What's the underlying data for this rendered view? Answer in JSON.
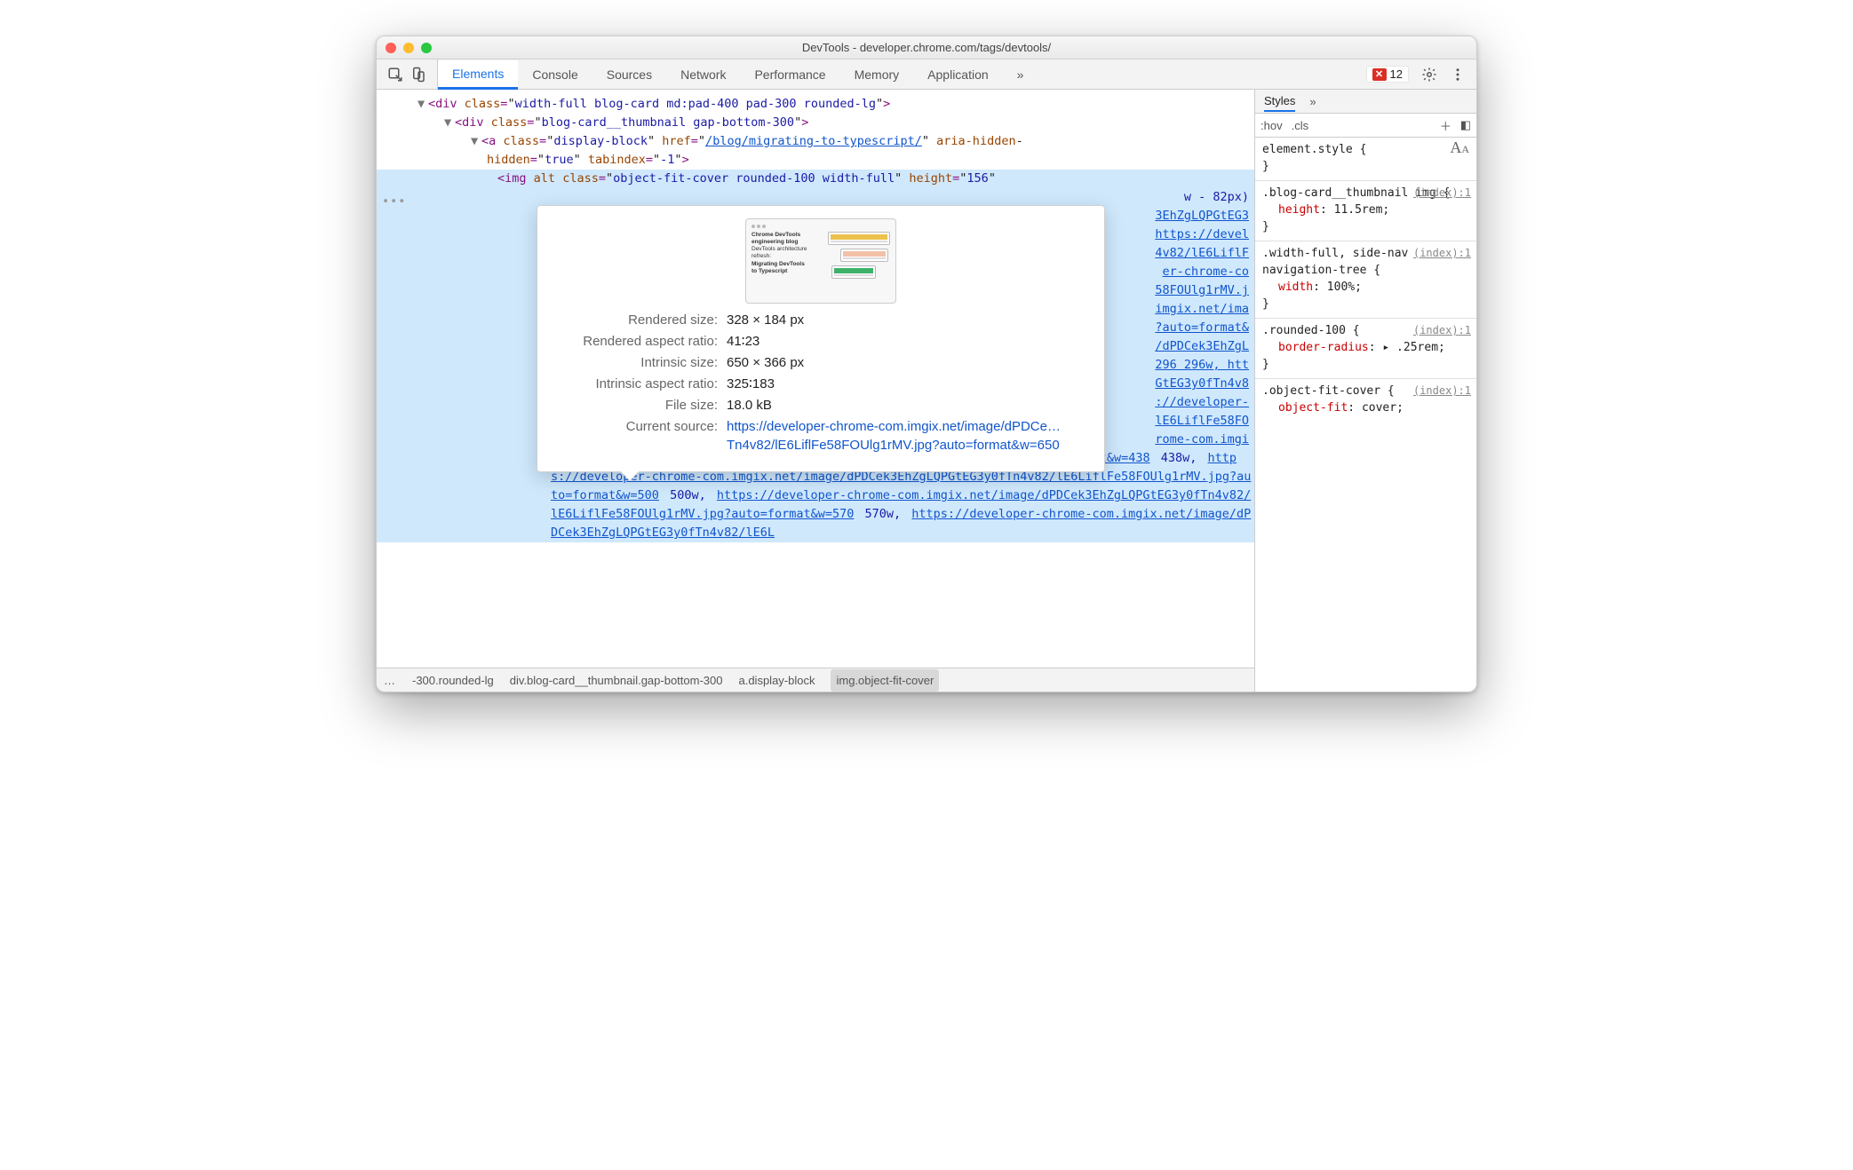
{
  "window": {
    "title": "DevTools - developer.chrome.com/tags/devtools/"
  },
  "toolbar": {
    "tabs": [
      "Elements",
      "Console",
      "Sources",
      "Network",
      "Performance",
      "Memory",
      "Application"
    ],
    "active": 0,
    "errors": "12"
  },
  "dom": {
    "line1_class": "width-full blog-card md:pad-400 pad-300 rounded-lg",
    "line2_class": "blog-card__thumbnail gap-bottom-300",
    "a_class": "display-block",
    "a_href": "/blog/migrating-to-typescript/",
    "a_aria_attr": "aria-hidden",
    "a_aria_val": "true",
    "a_tabindex_attr": "tabindex",
    "a_tabindex_val": "-1",
    "img_class": "object-fit-cover rounded-100 width-full",
    "img_height": "156",
    "vw_frag": "w - 82px)",
    "srcset_frags": [
      "3EhZgLQPGtEG3",
      "https://devel",
      "4v82/lE6LiflF",
      "er-chrome-co",
      "58FOUlg1rMV.j",
      "imgix.net/ima",
      "?auto=format&",
      "/dPDCek3EhZgL",
      "296 296w,  htt",
      "GtEG3y0fTn4v8",
      "://developer-",
      "lE6LiflFe58FO",
      "rome-com.imgi"
    ],
    "srcset_tail1": "x.net/image/dPDCek3EhZgLQPGtEG3y0fTn4v82/lE6LiflFe58FOUlg1rMV.jpg?auto=format&w=438",
    "srcset_tail1_w": "438w,",
    "srcset_tail2": "https://developer-chrome-com.imgix.net/image/dPDCek3EhZgLQPGtEG3y0fTn4v82/lE6LiflFe58FOUlg1rMV.jpg?auto=format&w=500",
    "srcset_tail2_w": "500w,",
    "srcset_tail3": "https://developer-chrome-com.imgix.net/image/dPDCek3EhZgLQPGtEG3y0fTn4v82/lE6LiflFe58FOUlg1rMV.jpg?auto=format&w=570",
    "srcset_tail3_w": "570w,",
    "srcset_tail4": "https://developer-chrome-com.imgix.net/image/dPDCek3EhZgLQPGtEG3y0fTn4v82/lE6L"
  },
  "overlay": {
    "thumb_title": "Chrome DevTools engineering blog",
    "thumb_sub1": "DevTools architecture refresh:",
    "thumb_sub2": "Migrating DevTools",
    "thumb_sub3": "to Typescript",
    "rows": {
      "rendered_size_label": "Rendered size:",
      "rendered_size_value": "328 × 184 px",
      "rendered_ar_label": "Rendered aspect ratio:",
      "rendered_ar_value": "41∶23",
      "intrinsic_size_label": "Intrinsic size:",
      "intrinsic_size_value": "650 × 366 px",
      "intrinsic_ar_label": "Intrinsic aspect ratio:",
      "intrinsic_ar_value": "325∶183",
      "file_size_label": "File size:",
      "file_size_value": "18.0 kB",
      "current_src_label": "Current source:",
      "current_src_value": "https://developer-chrome-com.imgix.net/image/dPDCe…Tn4v82/lE6LiflFe58FOUlg1rMV.jpg?auto=format&w=650"
    }
  },
  "styles": {
    "tab": "Styles",
    "hov": ":hov",
    "cls": ".cls",
    "rules": [
      {
        "selector": "element.style {",
        "src": "",
        "props": [],
        "close": "}",
        "aa": true
      },
      {
        "selector": ".blog-card__thumbnail img {",
        "src": "(index):1",
        "props": [
          {
            "n": "height",
            "v": "11.5rem;"
          }
        ],
        "close": "}"
      },
      {
        "selector": ".width-full, side-nav navigation-tree {",
        "src": "(index):1",
        "props": [
          {
            "n": "width",
            "v": "100%;"
          }
        ],
        "close": "}"
      },
      {
        "selector": ".rounded-100 {",
        "src": "(index):1",
        "props": [
          {
            "n": "border-radius",
            "v": " ▸ .25rem;"
          }
        ],
        "close": "}"
      },
      {
        "selector": ".object-fit-cover {",
        "src": "(index):1",
        "props": [
          {
            "n": "object-fit",
            "v": "cover;"
          }
        ],
        "close": ""
      }
    ]
  },
  "breadcrumbs": {
    "more": "…",
    "items": [
      "-300.rounded-lg",
      "div.blog-card__thumbnail.gap-bottom-300",
      "a.display-block",
      "img.object-fit-cover"
    ],
    "selected_index": 3
  }
}
